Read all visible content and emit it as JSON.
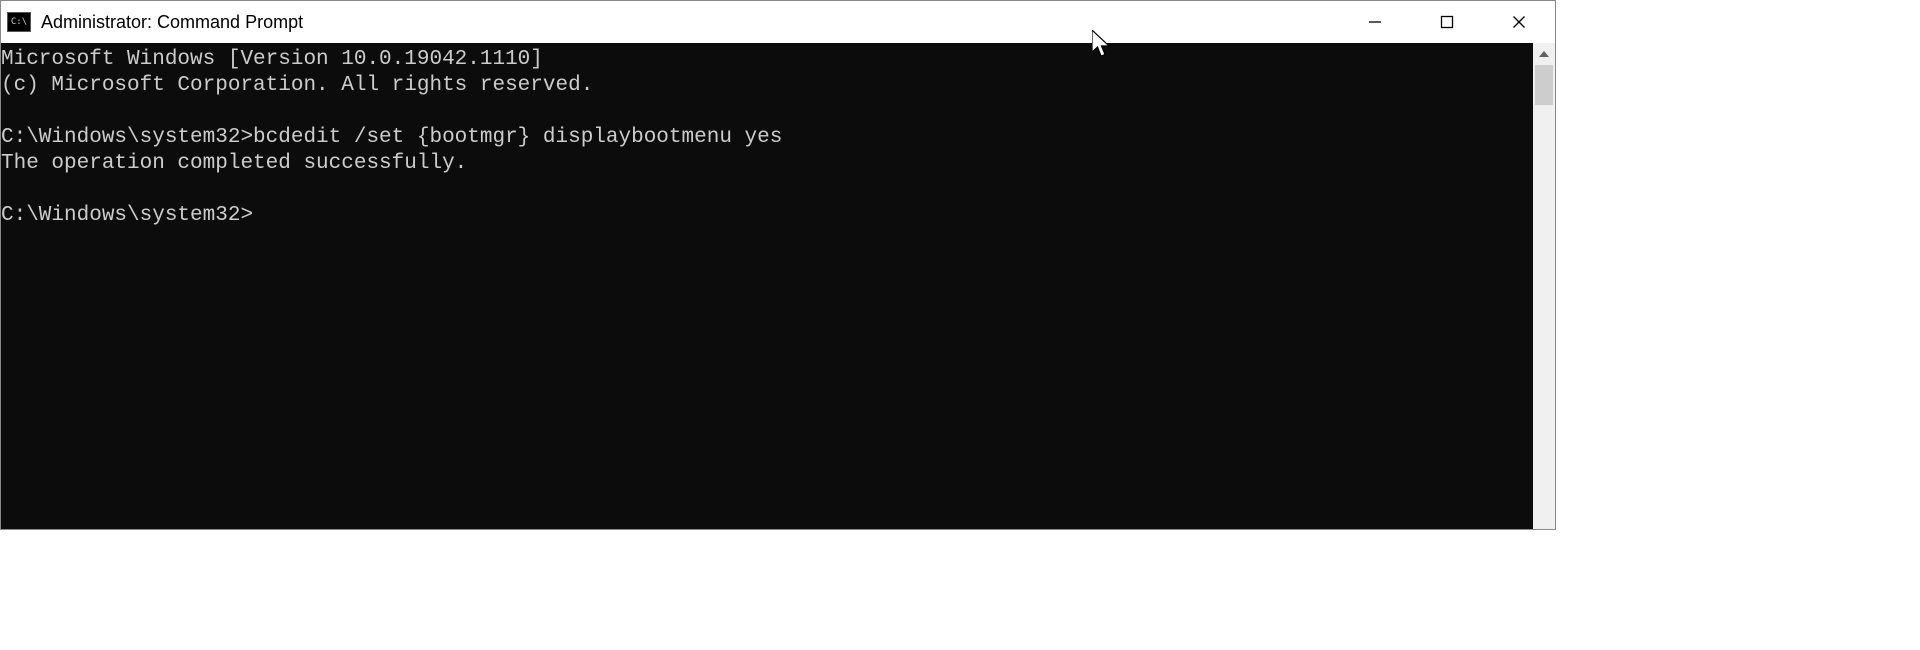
{
  "title": "Administrator: Command Prompt",
  "icon_label": "C:\\",
  "terminal": {
    "lines": [
      "Microsoft Windows [Version 10.0.19042.1110]",
      "(c) Microsoft Corporation. All rights reserved.",
      "",
      "C:\\Windows\\system32>bcdedit /set {bootmgr} displaybootmenu yes",
      "The operation completed successfully.",
      "",
      "C:\\Windows\\system32>"
    ]
  }
}
